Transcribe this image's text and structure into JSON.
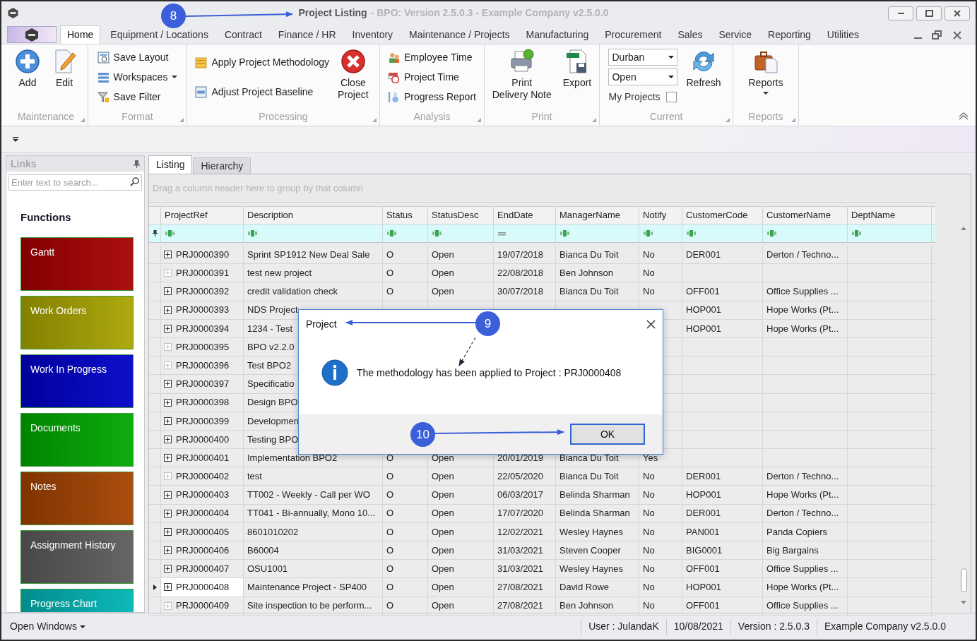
{
  "window": {
    "title": "Project Listing",
    "subtitle": "- BPO: Version 2.5.0.3 - Example Company v2.5.0.0"
  },
  "ribbon_tabs": [
    {
      "label": "Home",
      "selected": true
    },
    {
      "label": "Equipment / Locations",
      "selected": false
    },
    {
      "label": "Contract",
      "selected": false
    },
    {
      "label": "Finance / HR",
      "selected": false
    },
    {
      "label": "Inventory",
      "selected": false
    },
    {
      "label": "Maintenance / Projects",
      "selected": false
    },
    {
      "label": "Manufacturing",
      "selected": false
    },
    {
      "label": "Procurement",
      "selected": false
    },
    {
      "label": "Sales",
      "selected": false
    },
    {
      "label": "Service",
      "selected": false
    },
    {
      "label": "Reporting",
      "selected": false
    },
    {
      "label": "Utilities",
      "selected": false
    }
  ],
  "ribbon_groups": [
    {
      "label": "Maintenance",
      "columns": [
        [
          {
            "kind": "large",
            "label": "Add"
          }
        ],
        [
          {
            "kind": "large",
            "label": "Edit"
          }
        ]
      ]
    },
    {
      "label": "Format",
      "columns": [
        [
          {
            "kind": "small",
            "label": "Save Layout"
          },
          {
            "kind": "small",
            "label": "Workspaces",
            "menu": true
          },
          {
            "kind": "small",
            "label": "Save Filter"
          }
        ]
      ]
    },
    {
      "label": "Processing",
      "columns": [
        [
          {
            "kind": "small",
            "label": "Apply Project Methodology"
          },
          {
            "kind": "small",
            "label": "Adjust Project Baseline"
          }
        ],
        [
          {
            "kind": "large",
            "label": "Close\nProject"
          }
        ]
      ]
    },
    {
      "label": "Analysis",
      "columns": [
        [
          {
            "kind": "small",
            "label": "Employee Time"
          },
          {
            "kind": "small",
            "label": "Project Time"
          },
          {
            "kind": "small",
            "label": "Progress Report"
          }
        ]
      ]
    },
    {
      "label": "Print",
      "columns": [
        [
          {
            "kind": "large",
            "label": "Print\nDelivery Note"
          }
        ],
        [
          {
            "kind": "large",
            "label": "Export"
          }
        ]
      ]
    },
    {
      "label": "Current",
      "columns": [
        [
          {
            "kind": "combo",
            "value": "Durban"
          },
          {
            "kind": "combo",
            "value": "Open"
          },
          {
            "kind": "checkbox",
            "label": "My Projects",
            "checked": false
          }
        ],
        [
          {
            "kind": "large",
            "label": "Refresh"
          }
        ]
      ]
    },
    {
      "label": "Reports",
      "columns": [
        [
          {
            "kind": "large",
            "label": "Reports",
            "menu": true
          }
        ]
      ]
    }
  ],
  "links_panel": {
    "title": "Links",
    "search": {
      "placeholder": "Enter text to search..."
    },
    "heading": "Functions",
    "tiles": [
      {
        "label": "Gantt",
        "color": "#a80000"
      },
      {
        "label": "Work Orders",
        "color": "#a8a400"
      },
      {
        "label": "Work In Progress",
        "color": "#0000c8"
      },
      {
        "label": "Documents",
        "color": "#00a800"
      },
      {
        "label": "Notes",
        "color": "#a44200"
      },
      {
        "label": "Assignment History",
        "color": "#5c5c5c"
      },
      {
        "label": "Progress Chart",
        "color": "#00b4b4"
      }
    ]
  },
  "view_tabs": [
    {
      "label": "Listing",
      "selected": true
    },
    {
      "label": "Hierarchy",
      "selected": false
    }
  ],
  "group_panel_hint": "Drag a column header here to group by that column",
  "table": {
    "columns": [
      {
        "label": "ProjectRef"
      },
      {
        "label": "Description"
      },
      {
        "label": "Status"
      },
      {
        "label": "StatusDesc"
      },
      {
        "label": "EndDate"
      },
      {
        "label": "ManagerName"
      },
      {
        "label": "Notify"
      },
      {
        "label": "CustomerCode"
      },
      {
        "label": "CustomerName"
      },
      {
        "label": "DeptName"
      }
    ],
    "rows": [
      {
        "ref": "PRJ0000390",
        "description": "Sprint SP1912 New Deal Sale",
        "status": "O",
        "status_desc": "Open",
        "end_date": "19/07/2018",
        "manager": "Bianca Du Toit",
        "notify": "No",
        "customer_code": "DER001",
        "customer_name": "Derton / Techno...",
        "has_children": true,
        "selected": false
      },
      {
        "ref": "PRJ0000391",
        "description": "test new project",
        "status": "O",
        "status_desc": "Open",
        "end_date": "22/08/2018",
        "manager": "Ben Johnson",
        "notify": "No",
        "has_children": false,
        "selected": false
      },
      {
        "ref": "PRJ0000392",
        "description": "credit validation check",
        "status": "O",
        "status_desc": "Open",
        "end_date": "30/07/2018",
        "manager": "Bianca Du Toit",
        "notify": "No",
        "customer_code": "OFF001",
        "customer_name": "Office Supplies ...",
        "has_children": true,
        "selected": false
      },
      {
        "ref": "PRJ0000393",
        "description": "NDS Project",
        "customer_code": "HOP001",
        "customer_name": "Hope Works (Pt...",
        "has_children": true,
        "selected": false
      },
      {
        "ref": "PRJ0000394",
        "description": "1234 - Test",
        "customer_code": "HOP001",
        "customer_name": "Hope Works (Pt...",
        "has_children": true,
        "selected": false
      },
      {
        "ref": "PRJ0000395",
        "description": "BPO v2.2.0",
        "has_children": false,
        "selected": false
      },
      {
        "ref": "PRJ0000396",
        "description": "Test BPO2",
        "has_children": false,
        "selected": false
      },
      {
        "ref": "PRJ0000397",
        "description": "Specificatio",
        "has_children": true,
        "selected": false
      },
      {
        "ref": "PRJ0000398",
        "description": "Design BPO",
        "has_children": true,
        "selected": false
      },
      {
        "ref": "PRJ0000399",
        "description": "Developmen",
        "has_children": true,
        "selected": false
      },
      {
        "ref": "PRJ0000400",
        "description": "Testing BPO",
        "has_children": true,
        "selected": false
      },
      {
        "ref": "PRJ0000401",
        "description": "Implementation BPO2",
        "status": "O",
        "status_desc": "Open",
        "end_date": "20/01/2019",
        "manager": "Bianca Du Toit",
        "notify": "Yes",
        "has_children": true,
        "selected": false
      },
      {
        "ref": "PRJ0000402",
        "description": "test",
        "status": "O",
        "status_desc": "Open",
        "end_date": "22/05/2020",
        "manager": "Bianca Du Toit",
        "notify": "No",
        "customer_code": "DER001",
        "customer_name": "Derton / Techno...",
        "has_children": false,
        "selected": false
      },
      {
        "ref": "PRJ0000403",
        "description": "TT002 - Weekly - Call per WO",
        "status": "O",
        "status_desc": "Open",
        "end_date": "06/03/2017",
        "manager": "Belinda Sharman",
        "notify": "No",
        "customer_code": "HOP001",
        "customer_name": "Hope Works (Pt...",
        "has_children": true,
        "selected": false
      },
      {
        "ref": "PRJ0000404",
        "description": "TT041 - Bi-annually, Mono 10...",
        "status": "O",
        "status_desc": "Open",
        "end_date": "17/07/2020",
        "manager": "Belinda Sharman",
        "notify": "No",
        "customer_code": "DER001",
        "customer_name": "Derton / Techno...",
        "has_children": true,
        "selected": false
      },
      {
        "ref": "PRJ0000405",
        "description": "8601010202",
        "status": "O",
        "status_desc": "Open",
        "end_date": "12/02/2021",
        "manager": "Wesley Haynes",
        "notify": "No",
        "customer_code": "PAN001",
        "customer_name": "Panda Copiers",
        "has_children": true,
        "selected": false
      },
      {
        "ref": "PRJ0000406",
        "description": "B60004",
        "status": "O",
        "status_desc": "Open",
        "end_date": "31/03/2021",
        "manager": "Steven Cooper",
        "notify": "No",
        "customer_code": "BIG0001",
        "customer_name": "Big Bargains",
        "has_children": true,
        "selected": false
      },
      {
        "ref": "PRJ0000407",
        "description": "OSU1001",
        "status": "O",
        "status_desc": "Open",
        "end_date": "31/03/2021",
        "manager": "Wesley Haynes",
        "notify": "No",
        "customer_code": "OFF001",
        "customer_name": "Office Supplies ...",
        "has_children": true,
        "selected": false
      },
      {
        "ref": "PRJ0000408",
        "description": "Maintenance Project - SP400",
        "status": "O",
        "status_desc": "Open",
        "end_date": "27/08/2021",
        "manager": "David Rowe",
        "notify": "No",
        "customer_code": "HOP001",
        "customer_name": "Hope Works (Pt...",
        "has_children": true,
        "selected": true
      },
      {
        "ref": "PRJ0000409",
        "description": "Site inspection to be perform...",
        "status": "O",
        "status_desc": "Open",
        "end_date": "27/08/2021",
        "manager": "Ben Johnson",
        "notify": "No",
        "customer_code": "OFF001",
        "customer_name": "Office Supplies ...",
        "has_children": false,
        "selected": false
      }
    ]
  },
  "status_bar": {
    "open_windows": "Open Windows",
    "user": "User : JulandaK",
    "date": "10/08/2021",
    "version": "Version : 2.5.0.3",
    "company": "Example Company v2.5.0.0"
  },
  "dialog": {
    "title": "Project",
    "message": "The methodology has been applied to Project : PRJ0000408",
    "button": "OK"
  },
  "callouts": [
    {
      "number": "8"
    },
    {
      "number": "9"
    },
    {
      "number": "10"
    }
  ]
}
